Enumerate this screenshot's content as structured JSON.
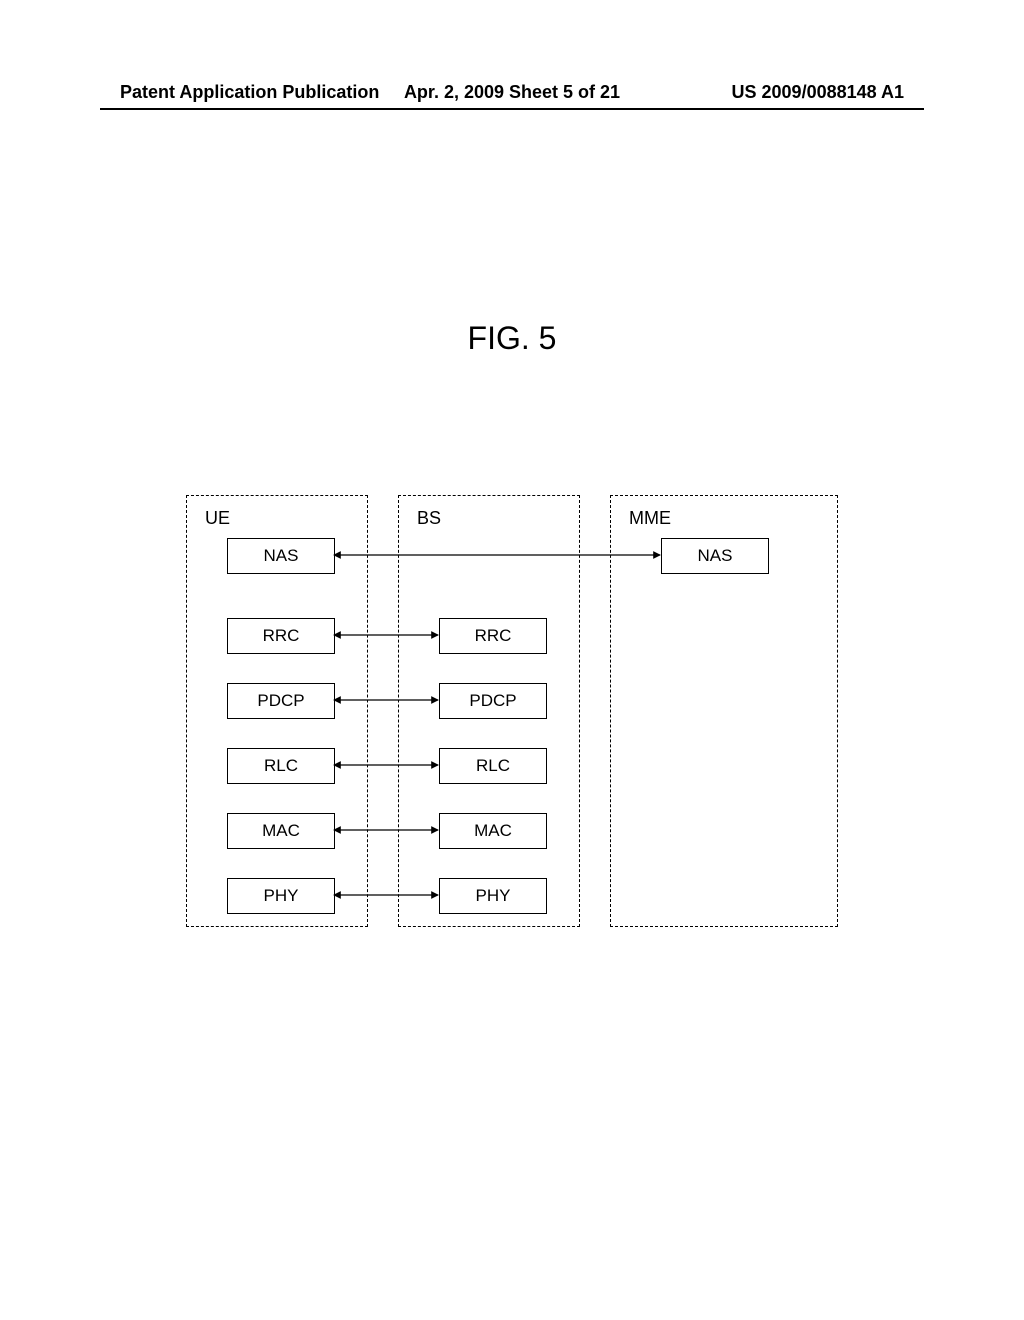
{
  "header": {
    "left": "Patent Application Publication",
    "mid": "Apr. 2, 2009  Sheet 5 of 21",
    "right": "US 2009/0088148 A1"
  },
  "figure_title": "FIG. 5",
  "stacks": {
    "ue": {
      "title": "UE",
      "layers": [
        "NAS",
        "RRC",
        "PDCP",
        "RLC",
        "MAC",
        "PHY"
      ]
    },
    "bs": {
      "title": "BS",
      "layers": [
        "RRC",
        "PDCP",
        "RLC",
        "MAC",
        "PHY"
      ]
    },
    "mme": {
      "title": "MME",
      "layers": [
        "NAS"
      ]
    }
  },
  "connections": [
    {
      "from": "ue.NAS",
      "to": "mme.NAS"
    },
    {
      "from": "ue.RRC",
      "to": "bs.RRC"
    },
    {
      "from": "ue.PDCP",
      "to": "bs.PDCP"
    },
    {
      "from": "ue.RLC",
      "to": "bs.RLC"
    },
    {
      "from": "ue.MAC",
      "to": "bs.MAC"
    },
    {
      "from": "ue.PHY",
      "to": "bs.PHY"
    }
  ]
}
